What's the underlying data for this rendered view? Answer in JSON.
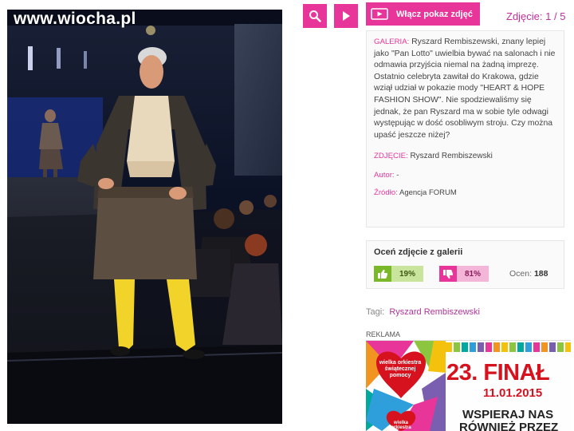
{
  "site": {
    "watermark": "www.wiocha.pl"
  },
  "toolbar": {
    "search_icon": "search-icon",
    "next_icon": "play-next-icon"
  },
  "gallery": {
    "slideshow_label": "Włącz pokaz zdjęć",
    "counter": "Zdjęcie: 1 / 5",
    "accent_color": "#e8359a",
    "description_label": "GALERIA:",
    "description": "Ryszard Rembiszewski, znany lepiej jako \"Pan Lotto\" uwielbia bywać na salonach i nie odmawia przyjścia niemal na żadną imprezę. Ostatnio celebryta zawitał do Krakowa, gdzie wziął udział w pokazie mody \"HEART & HOPE FASHION SHOW\". Nie spodziewaliśmy się jednak, że pan Ryszard ma w sobie tyle odwagi występując w dość osobliwym stroju. Czy można upaść jeszcze niżej?",
    "photo_label": "ZDJĘCIE:",
    "photo_value": "Ryszard Rembiszewski",
    "author_label": "Autor:",
    "author_value": "-",
    "source_label": "Źródło:",
    "source_value": "Agencja FORUM"
  },
  "rating": {
    "title": "Oceń zdjęcie z galerii",
    "up_percent": "19%",
    "down_percent": "81%",
    "total_label": "Ocen:",
    "total_value": "188",
    "up_color": "#7ab829",
    "down_color": "#e8359a"
  },
  "tags": {
    "label": "Tagi:",
    "items": [
      "Ryszard Rembiszewski"
    ]
  },
  "ad": {
    "label": "REKLAMA",
    "heart_text": "wielka orkiestra świątecznej pomocy",
    "heart_text_small": "wielka orkiestra",
    "headline": "23. FINAŁ",
    "date": "11.01.2015",
    "line1": "WSPIERAJ NAS",
    "line2": "RÓWNIEŻ PRZEZ"
  }
}
